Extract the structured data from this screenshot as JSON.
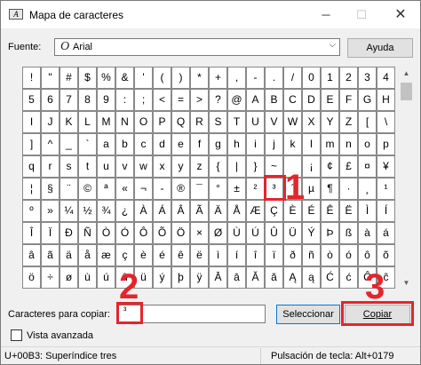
{
  "window": {
    "title": "Mapa de caracteres",
    "minimize": "─",
    "maximize": "☐",
    "close": "✕",
    "app_icon": "A"
  },
  "font": {
    "label": "Fuente:",
    "value": "Arial",
    "icon": "O",
    "dropdown": "⌵"
  },
  "help_button": "Ayuda",
  "grid": {
    "rows": [
      [
        "!",
        "\"",
        "#",
        "$",
        "%",
        "&",
        "'",
        "(",
        ")",
        "*",
        "+",
        ",",
        "-",
        ".",
        "/",
        "0",
        "1",
        "2",
        "3",
        "4"
      ],
      [
        "5",
        "6",
        "7",
        "8",
        "9",
        ":",
        ";",
        "<",
        "=",
        ">",
        "?",
        "@",
        "A",
        "B",
        "C",
        "D",
        "E",
        "F",
        "G",
        "H"
      ],
      [
        "I",
        "J",
        "K",
        "L",
        "M",
        "N",
        "O",
        "P",
        "Q",
        "R",
        "S",
        "T",
        "U",
        "V",
        "W",
        "X",
        "Y",
        "Z",
        "[",
        "\\"
      ],
      [
        "]",
        "^",
        "_",
        "`",
        "a",
        "b",
        "c",
        "d",
        "e",
        "f",
        "g",
        "h",
        "i",
        "j",
        "k",
        "l",
        "m",
        "n",
        "o",
        "p"
      ],
      [
        "q",
        "r",
        "s",
        "t",
        "u",
        "v",
        "w",
        "x",
        "y",
        "z",
        "{",
        "|",
        "}",
        "~",
        " ",
        "¡",
        "¢",
        "£",
        "¤",
        "¥"
      ],
      [
        "¦",
        "§",
        "¨",
        "©",
        "ª",
        "«",
        "¬",
        "-",
        "®",
        "¯",
        "°",
        "±",
        "²",
        "³",
        "´",
        "µ",
        "¶",
        "·",
        "¸",
        "¹"
      ],
      [
        "º",
        "»",
        "¼",
        "½",
        "¾",
        "¿",
        "À",
        "Á",
        "Â",
        "Ã",
        "Ä",
        "Å",
        "Æ",
        "Ç",
        "È",
        "É",
        "Ê",
        "Ë",
        "Ì",
        "Í"
      ],
      [
        "Î",
        "Ï",
        "Ð",
        "Ñ",
        "Ò",
        "Ó",
        "Ô",
        "Õ",
        "Ö",
        "×",
        "Ø",
        "Ù",
        "Ú",
        "Û",
        "Ü",
        "Ý",
        "Þ",
        "ß",
        "à",
        "á"
      ],
      [
        "â",
        "ã",
        "ä",
        "å",
        "æ",
        "ç",
        "è",
        "é",
        "ê",
        "ë",
        "ì",
        "í",
        "î",
        "ï",
        "ð",
        "ñ",
        "ò",
        "ó",
        "ô",
        "õ"
      ],
      [
        "ö",
        "÷",
        "ø",
        "ù",
        "ú",
        "û",
        "ü",
        "ý",
        "þ",
        "ÿ",
        "Ā",
        "ā",
        "Ă",
        "ă",
        "Ą",
        "ą",
        "Ć",
        "ć",
        "Ĉ",
        "ĉ"
      ]
    ]
  },
  "scrollbar": {
    "up": "▲",
    "down": "▼"
  },
  "copy": {
    "label": "Caracteres para copiar:",
    "value": "³",
    "select_button": "Seleccionar",
    "copy_button": "Copiar"
  },
  "advanced_view": {
    "label": "Vista avanzada",
    "checked": false
  },
  "status": {
    "left": "U+00B3: Superíndice tres",
    "right": "Pulsación de tecla: Alt+0179"
  },
  "annotations": {
    "step1": "1",
    "step2": "2",
    "step3": "3",
    "color": "#e5242b"
  }
}
